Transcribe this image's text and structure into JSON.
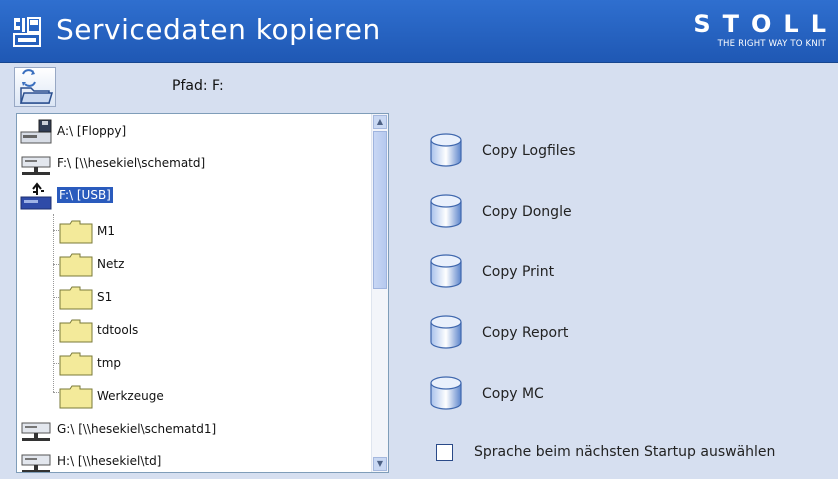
{
  "window": {
    "title": "Servicedaten kopieren"
  },
  "brand": {
    "name": "STOLL",
    "tagline": "THE RIGHT WAY TO KNIT"
  },
  "path": {
    "label": "Pfad:  F:"
  },
  "tree": {
    "items": [
      {
        "label": "A:\\  [Floppy]",
        "icon": "floppy-drive-icon"
      },
      {
        "label": "F:\\  [\\\\hesekiel\\schematd]",
        "icon": "network-drive-icon"
      },
      {
        "label": "F:\\  [USB]",
        "icon": "usb-drive-icon",
        "selected": true
      },
      {
        "label": "M1",
        "icon": "folder-icon"
      },
      {
        "label": "Netz",
        "icon": "folder-icon"
      },
      {
        "label": "S1",
        "icon": "folder-icon"
      },
      {
        "label": "tdtools",
        "icon": "folder-icon"
      },
      {
        "label": "tmp",
        "icon": "folder-icon"
      },
      {
        "label": "Werkzeuge",
        "icon": "folder-icon"
      },
      {
        "label": "G:\\  [\\\\hesekiel\\schematd1]",
        "icon": "network-drive-icon"
      },
      {
        "label": "H:\\  [\\\\hesekiel\\td]",
        "icon": "network-drive-icon"
      }
    ]
  },
  "actions": [
    {
      "label": "Copy Logfiles"
    },
    {
      "label": "Copy Dongle"
    },
    {
      "label": "Copy Print"
    },
    {
      "label": "Copy Report"
    },
    {
      "label": "Copy MC"
    }
  ],
  "startup_checkbox": {
    "label": "Sprache beim nächsten Startup auswählen",
    "checked": false
  },
  "colors": {
    "titlebar": "#2563c4",
    "background": "#d6dff0",
    "selection": "#2a5bbd"
  }
}
